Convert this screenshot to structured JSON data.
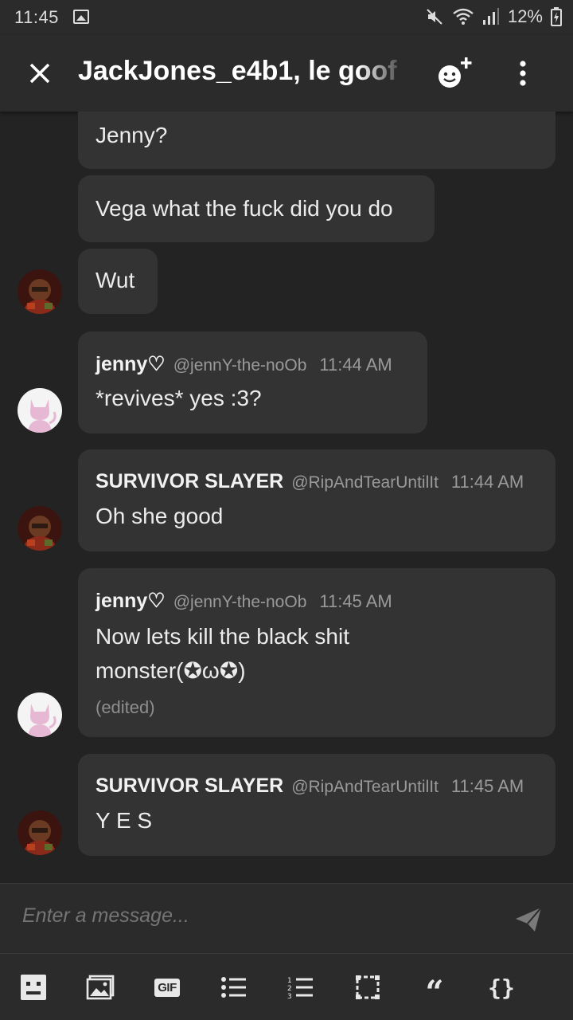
{
  "status_bar": {
    "time": "11:45",
    "battery": "12%"
  },
  "header": {
    "title": "JackJones_e4b1, le goof"
  },
  "messages": [
    {
      "type": "continuation",
      "text": "Jenny?"
    },
    {
      "type": "continuation",
      "text": "Vega what the fuck did you do"
    },
    {
      "type": "continuation",
      "text": "Wut",
      "avatar": "doom-avatar"
    },
    {
      "type": "full",
      "author": "jenny♡",
      "handle": "@jennY-the-noOb",
      "time": "11:44 AM",
      "lines": [
        "*revives* yes :3?"
      ],
      "avatar": "cat-avatar"
    },
    {
      "type": "full",
      "author": "SURVIVOR SLAYER",
      "handle": "@RipAndTearUntilIt",
      "time": "11:44 AM",
      "lines": [
        "Oh she good"
      ],
      "avatar": "doom-avatar"
    },
    {
      "type": "full",
      "author": "jenny♡",
      "handle": "@jennY-the-noOb",
      "time": "11:45 AM",
      "lines": [
        "Now lets kill the black shit",
        "monster(✪ω✪)"
      ],
      "edited": "(edited)",
      "avatar": "cat-avatar"
    },
    {
      "type": "full",
      "author": "SURVIVOR SLAYER",
      "handle": "@RipAndTearUntilIt",
      "time": "11:45 AM",
      "lines": [
        "Y E S"
      ],
      "avatar": "doom-avatar"
    }
  ],
  "composer": {
    "placeholder": "Enter a message..."
  },
  "toolbar": {
    "gif_label": "GIF",
    "quote_label": "“",
    "code_label": "{}"
  },
  "colors": {
    "background": "#232323",
    "bar": "#2b2b2b",
    "bubble": "#333333",
    "muted_text": "#9a9a9a"
  }
}
